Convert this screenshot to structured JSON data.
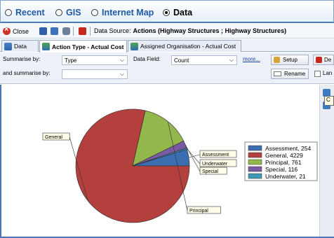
{
  "nav": {
    "options": [
      {
        "label": "Recent",
        "selected": false
      },
      {
        "label": "GIS",
        "selected": false
      },
      {
        "label": "Internet Map",
        "selected": false
      },
      {
        "label": "Data",
        "selected": true
      }
    ]
  },
  "toolbar": {
    "close_label": "Close",
    "data_source_label": "Data Source:",
    "data_source_value": "Actions (Highway Structures ; Highway Structures)"
  },
  "tabs": [
    {
      "label": "Data",
      "icon": "grid-icon",
      "active": false
    },
    {
      "label": "Action Type - Actual Cost",
      "icon": "chart-icon",
      "active": true
    },
    {
      "label": "Assigned Organisation - Actual Cost",
      "icon": "chart-icon",
      "active": false
    }
  ],
  "options": {
    "summarise_by_label": "Summarise by:",
    "summarise_by_value": "Type",
    "and_summarise_by_label": "and summarise by:",
    "and_summarise_by_value": "",
    "data_field_label": "Data Field:",
    "data_field_value": "Count",
    "more_label": "more...",
    "setup_label": "Setup",
    "rename_label": "Rename",
    "delete_label": "De",
    "landscape_label": "Lan"
  },
  "tooltip": {
    "text": "C"
  },
  "chart_data": {
    "type": "pie",
    "categories": [
      "Assessment",
      "General",
      "Principal",
      "Special",
      "Underwater"
    ],
    "values": [
      254,
      4229,
      761,
      116,
      21
    ],
    "colors": [
      "#3b6db0",
      "#b3403c",
      "#92b84c",
      "#7a5aa3",
      "#3c9ab3"
    ],
    "legend": [
      "Assessment, 254",
      "General, 4229",
      "Principal, 761",
      "Special, 116",
      "Underwater, 21"
    ],
    "slice_labels": [
      "Assessment",
      "General",
      "Principal",
      "Special",
      "Underwater"
    ],
    "legend_position": "right"
  }
}
